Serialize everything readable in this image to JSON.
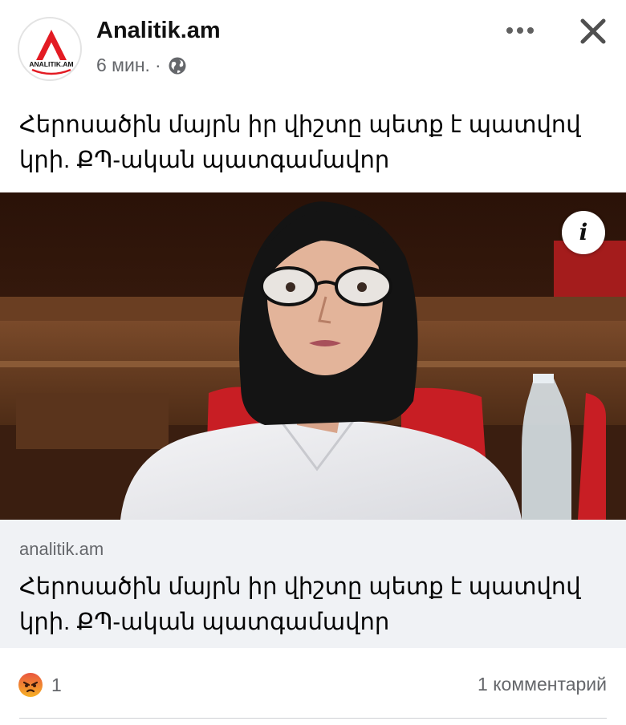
{
  "post": {
    "page_name": "Analitik.am",
    "time": "6 мин.",
    "separator": "·",
    "privacy_icon": "globe-icon",
    "caption": "Հերոսածին մայրն իր վիշտը պետք է պատվով կրի. ՔՊ-ական պատգամավոր"
  },
  "avatar": {
    "logo_text": "ANALITIK.AM",
    "brand_color": "#e31b23"
  },
  "photo": {
    "info_label": "i"
  },
  "link_preview": {
    "domain": "analitik.am",
    "title": "Հերոսածին մայրն իր վիշտը պետք է պատվով կրի. ՔՊ-ական պատգամավոր"
  },
  "footer": {
    "reaction_icon": "angry-reaction-icon",
    "reaction_count": "1",
    "comments_label": "1 комментарий"
  },
  "colors": {
    "secondary_text": "#65676b",
    "preview_bg": "#f0f2f5"
  }
}
